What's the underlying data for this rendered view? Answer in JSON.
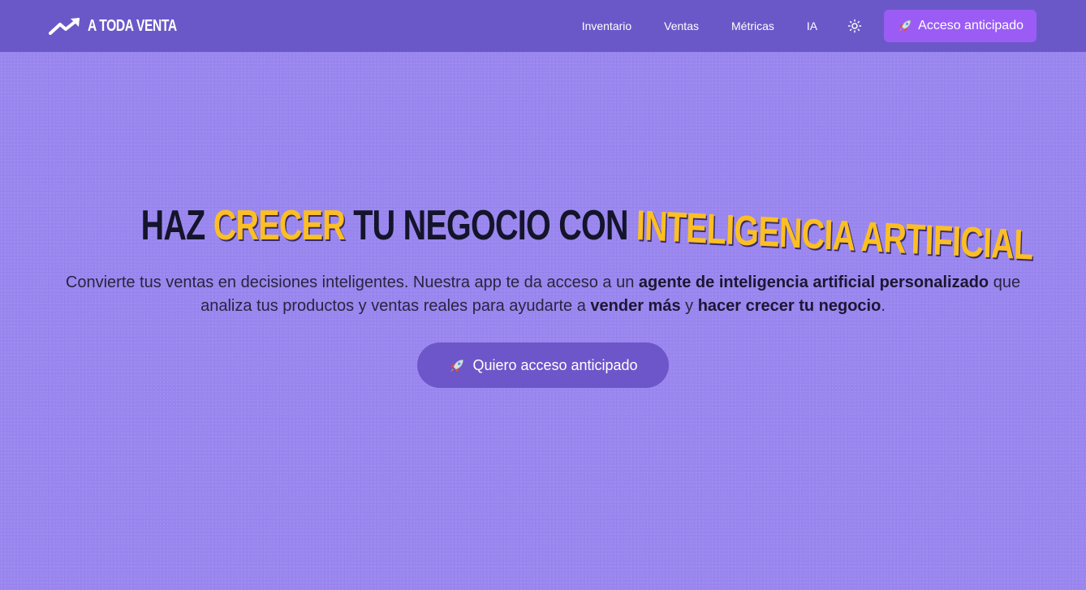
{
  "header": {
    "brand": "A TODA VENTA",
    "brand_icon": "trending-up-icon",
    "nav": [
      {
        "label": "Inventario"
      },
      {
        "label": "Ventas"
      },
      {
        "label": "Métricas"
      },
      {
        "label": "IA"
      }
    ],
    "theme_icon": "sun-icon",
    "cta_label": "Acceso anticipado",
    "cta_icon": "rocket-icon"
  },
  "hero": {
    "title_part1": "HAZ",
    "title_highlight1": "CRECER",
    "title_part2": "TU NEGOCIO CON",
    "title_highlight2": "INTELIGENCIA ARTIFICIAL",
    "subtitle": {
      "s1": "Convierte tus ventas en decisiones inteligentes. Nuestra app te da acceso a un ",
      "b1": "agente de inteligencia artificial personalizado",
      "s2": " que analiza tus productos y ventas reales para ayudarte a ",
      "b2": "vender más",
      "s3": " y ",
      "b3": "hacer crecer tu negocio",
      "s4": "."
    },
    "cta_label": "Quiero acceso anticipado",
    "cta_icon": "rocket-icon"
  },
  "colors": {
    "background": "#9a86ef",
    "header": "#6b58c8",
    "accent": "#9b5cf6",
    "highlight": "#fbbf24",
    "title": "#14142b"
  }
}
